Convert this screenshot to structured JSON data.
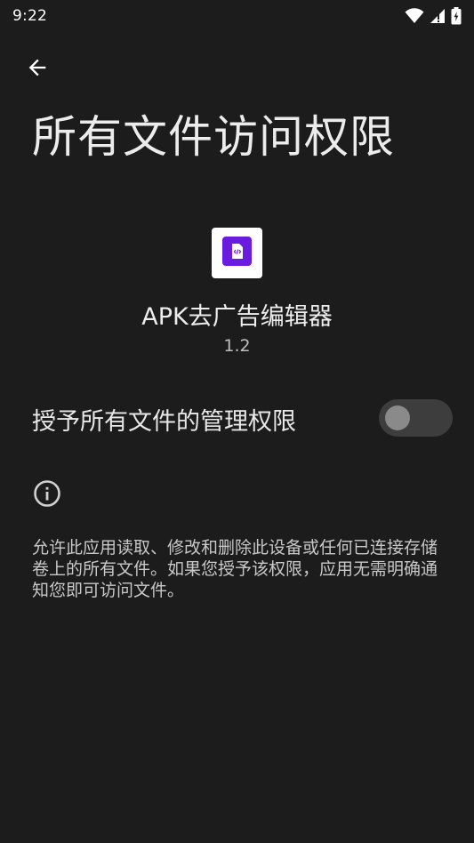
{
  "status_bar": {
    "time": "9:22",
    "icons": [
      "wifi-icon",
      "signal-icon",
      "battery-charging-icon"
    ]
  },
  "header": {
    "back_icon": "arrow-left-icon",
    "title": "所有文件访问权限"
  },
  "app": {
    "icon": "code-file-icon",
    "name": "APK去广告编辑器",
    "version": "1.2"
  },
  "permission": {
    "label": "授予所有文件的管理权限",
    "enabled": false
  },
  "info": {
    "icon": "info-icon",
    "description": "允许此应用读取、修改和删除此设备或任何已连接存储卷上的所有文件。如果您授予该权限，应用无需明确通知您即可访问文件。"
  },
  "colors": {
    "background": "#1c1c1c",
    "text": "#ececec",
    "app_icon_accent": "#6a1be0",
    "toggle_track_off": "#3d3d3d",
    "toggle_thumb_off": "#8a8a8a"
  }
}
